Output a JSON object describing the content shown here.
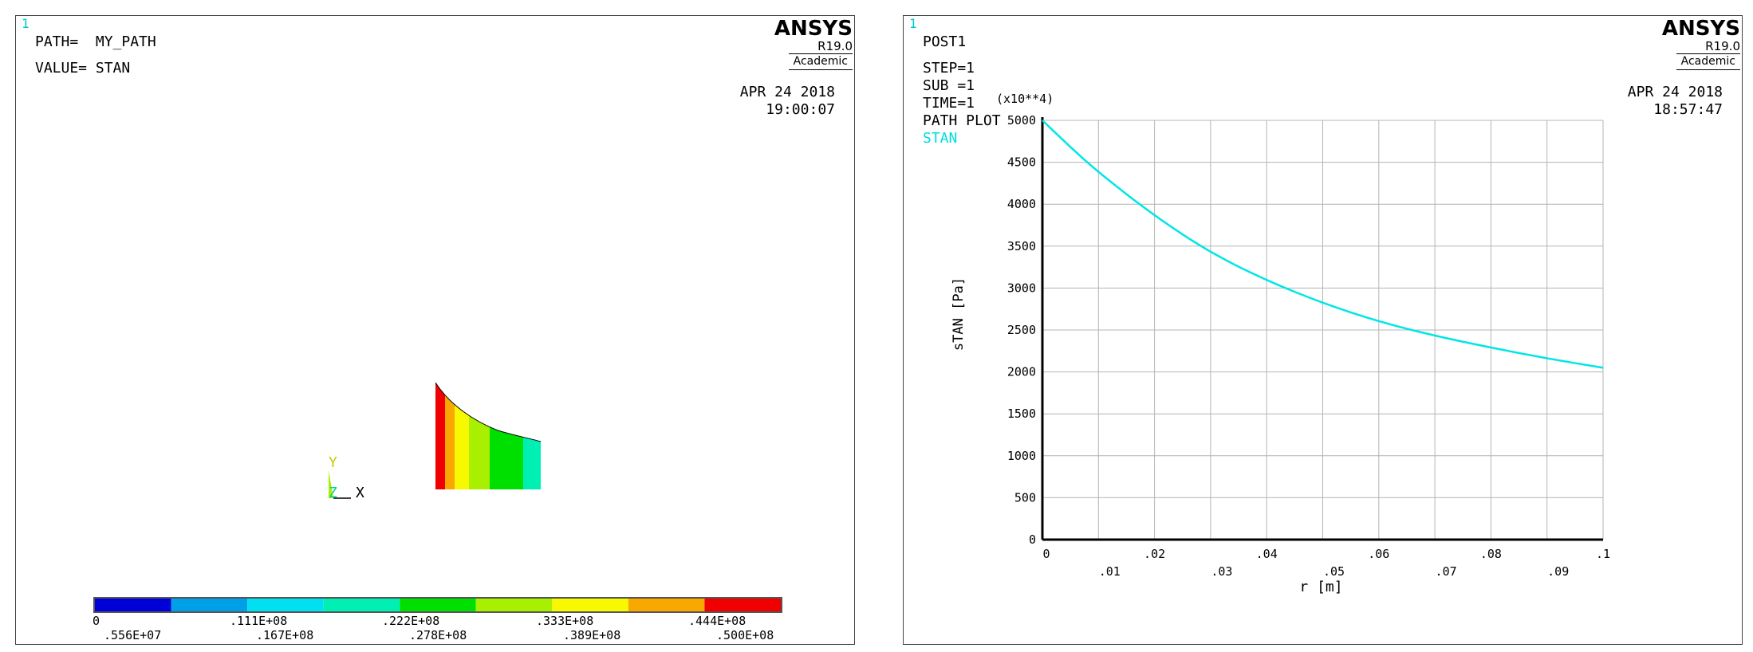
{
  "left_window": {
    "window_number": "1",
    "path_label": "PATH=  MY_PATH",
    "value_label": "VALUE= STAN",
    "brand": {
      "name": "ANSYS",
      "release": "R19.0",
      "edition": "Academic"
    },
    "date": "APR 24 2018",
    "time": "19:00:07",
    "triad": {
      "y": "Y",
      "z": "Z",
      "x": "X"
    },
    "contour_colors": [
      "#0000d8",
      "#00a0e8",
      "#00e0f0",
      "#00f0b4",
      "#00e000",
      "#a8f000",
      "#f8f800",
      "#f8a800",
      "#f00000"
    ],
    "legend_labels_top": [
      "0",
      ".111E+08",
      ".222E+08",
      ".333E+08",
      ".444E+08"
    ],
    "legend_labels_bottom": [
      ".556E+07",
      ".167E+08",
      ".278E+08",
      ".389E+08",
      ".500E+08"
    ]
  },
  "right_window": {
    "window_number": "1",
    "post_label": "POST1",
    "info_lines": [
      "STEP=1",
      "SUB =1",
      "TIME=1",
      "PATH PLOT"
    ],
    "series_label": "STAN",
    "brand": {
      "name": "ANSYS",
      "release": "R19.0",
      "edition": "Academic"
    },
    "date": "APR 24 2018",
    "time": "18:57:47",
    "y_multiplier": "(x10**4)"
  },
  "chart_data": {
    "type": "line",
    "xlabel": "r  [m]",
    "ylabel": "sTAN  [Pa]",
    "xlim": [
      0,
      0.1
    ],
    "ylim": [
      0,
      5000
    ],
    "x_ticks_upper": [
      "0",
      ".02",
      ".04",
      ".06",
      ".08",
      ".1"
    ],
    "x_ticks_lower": [
      ".01",
      ".03",
      ".05",
      ".07",
      ".09"
    ],
    "y_ticks": [
      "0",
      "500",
      "1000",
      "1500",
      "2000",
      "2500",
      "3000",
      "3500",
      "4000",
      "4500",
      "5000"
    ],
    "grid": true,
    "line_color": "#00e6e6",
    "series": [
      {
        "name": "STAN",
        "x": [
          0,
          0.005,
          0.01,
          0.02,
          0.03,
          0.04,
          0.05,
          0.06,
          0.07,
          0.08,
          0.09,
          0.1
        ],
        "values": [
          5000,
          4680,
          4380,
          3860,
          3420,
          3090,
          2820,
          2600,
          2430,
          2290,
          2160,
          2050
        ]
      }
    ]
  }
}
